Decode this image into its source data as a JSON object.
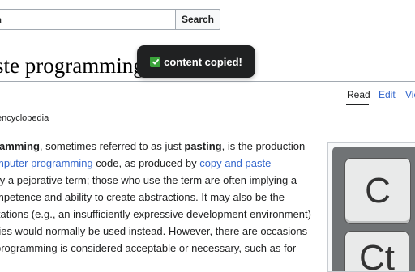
{
  "search": {
    "value": "a",
    "button_label": "Search"
  },
  "toast": {
    "icon": "check-mark-icon",
    "message": "content copied!",
    "color": "#202122"
  },
  "page": {
    "title": "aste programming"
  },
  "tabs": [
    {
      "label": "Read",
      "active": true
    },
    {
      "label": "Edit",
      "active": false
    },
    {
      "label": "Vie",
      "active": false
    }
  ],
  "tagline": "encyclopedia",
  "article": {
    "l1a": "ramming",
    "l1b": ", sometimes referred to as just ",
    "l1c": "pasting",
    "l1d": ", is the production",
    "l2a": "mputer programming",
    "l2b": " code, as produced by ",
    "l2c": "copy and paste",
    "l3": "lly a pejorative term; those who use the term are often implying a",
    "l4": "mpetence and ability to create abstractions. It may also be the",
    "l5": "itations (e.g., an insufficiently expressive development environment)",
    "l6": "ries would normally be used instead. However, there are occasions",
    "l7": " programming is considered acceptable or necessary, such as for"
  },
  "infobox": {
    "key1": "C",
    "key2": "Ct"
  },
  "colors": {
    "link": "#3366cc",
    "text": "#202122",
    "border": "#a2a9b1"
  }
}
